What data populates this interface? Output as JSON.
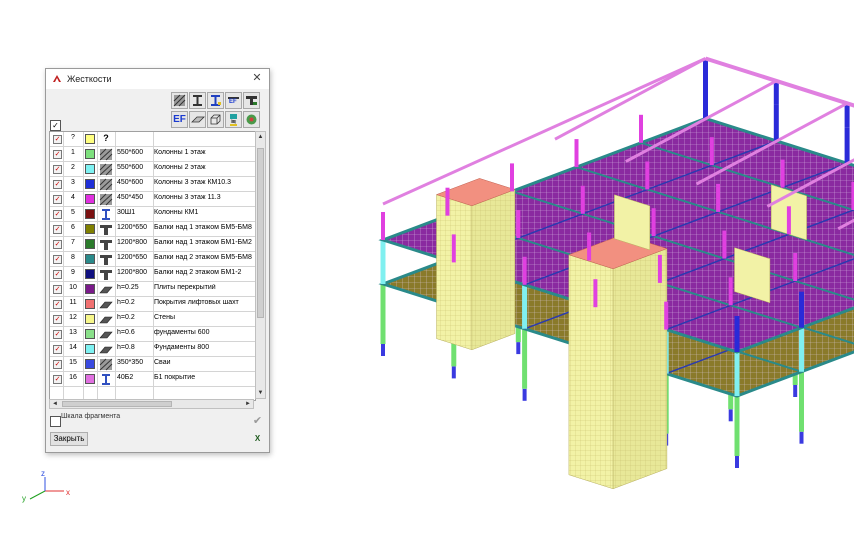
{
  "dialog": {
    "title": "Жесткости",
    "close_glyph": "✕",
    "check_all_mark": "✓",
    "header": {
      "num": "?",
      "icon": "?"
    },
    "rows": [
      {
        "num": "1",
        "color": "#7ee07e",
        "icon": "hatch",
        "size": "550*600",
        "name": "Колонны 1 этаж"
      },
      {
        "num": "2",
        "color": "#7ef2f2",
        "icon": "hatch",
        "size": "550*600",
        "name": "Колонны 2 этаж"
      },
      {
        "num": "3",
        "color": "#1f2fd8",
        "icon": "hatch",
        "size": "450*600",
        "name": "Колонны 3 этаж КМ10.3"
      },
      {
        "num": "4",
        "color": "#e030e0",
        "icon": "hatch",
        "size": "450*450",
        "name": "Колонны 3 этаж 11.3"
      },
      {
        "num": "5",
        "color": "#7a1010",
        "icon": "ibeam",
        "size": "30Ш1",
        "name": "Колонны КМ1"
      },
      {
        "num": "6",
        "color": "#808000",
        "icon": "tbeam",
        "size": "1200*650",
        "name": "Балки над 1 этажом БМ5-БМ8"
      },
      {
        "num": "7",
        "color": "#2a7a2a",
        "icon": "tbeam",
        "size": "1200*800",
        "name": "Балки над 1 этажом БМ1-БМ2"
      },
      {
        "num": "8",
        "color": "#2a8a8a",
        "icon": "tbeam",
        "size": "1200*650",
        "name": "Балки над 2 этажом БМ5-БМ8"
      },
      {
        "num": "9",
        "color": "#101080",
        "icon": "tbeam",
        "size": "1200*800",
        "name": "Балки над 2 этажом БМ1-2"
      },
      {
        "num": "10",
        "color": "#7a1a8a",
        "icon": "plate",
        "size": "h=0.25",
        "name": "Плиты перекрытий"
      },
      {
        "num": "11",
        "color": "#f07070",
        "icon": "plate",
        "size": "h=0.2",
        "name": "Покрытия лифтовых шахт"
      },
      {
        "num": "12",
        "color": "#f7f78a",
        "icon": "plate",
        "size": "h=0.2",
        "name": "Стены"
      },
      {
        "num": "13",
        "color": "#8ae08a",
        "icon": "plate",
        "size": "h=0.6",
        "name": "фундаменты 600"
      },
      {
        "num": "14",
        "color": "#7ef2f2",
        "icon": "plate",
        "size": "h=0.8",
        "name": "Фундаменты 800"
      },
      {
        "num": "15",
        "color": "#3a4ae0",
        "icon": "hatch",
        "size": "350*350",
        "name": "Сваи"
      },
      {
        "num": "16",
        "color": "#e070e0",
        "icon": "ibeam",
        "size": "40Б2",
        "name": "Б1 покрытие"
      }
    ],
    "fragment_label": "Шкала фрагмента",
    "apply_glyph": "✔",
    "close_button": "Закрыть",
    "export_label": "X",
    "scroll_up": "▲",
    "scroll_down": "▼",
    "scroll_left": "◄",
    "scroll_right": "►"
  },
  "toolbar_text": {
    "ef_small": "EF",
    "ef_large": "EF",
    "gear": "⚙"
  },
  "axes": {
    "x_label": "x",
    "y_label": "y",
    "z_label": "z"
  },
  "model_colors": {
    "slab": "#8a2aa0",
    "slab_grid": "#e8d8f0",
    "slab_edge_beam": "#2a8a8a",
    "wall": "#f2f2a6",
    "wall_grid": "#d8d080",
    "roof_shaft": "#f29080",
    "column_top": "#2a2ad8",
    "column_mid": "#e040e0",
    "column_l2": "#80f0f0",
    "column_l1": "#70e070",
    "roof_beam": "#e080e0",
    "pile": "#3a3ae0"
  }
}
